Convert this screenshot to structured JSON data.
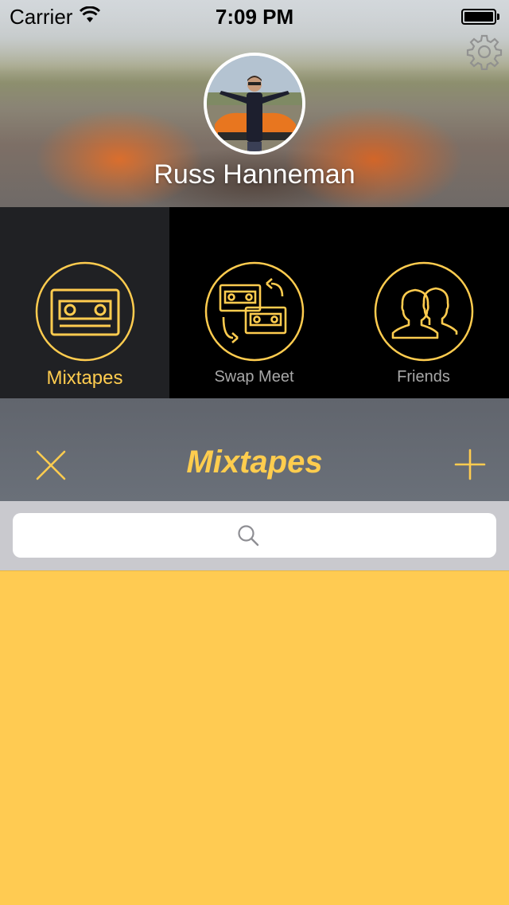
{
  "status_bar": {
    "carrier": "Carrier",
    "time": "7:09 PM",
    "wifi_icon": "wifi-icon",
    "battery_icon": "battery-full-icon"
  },
  "profile": {
    "name": "Russ Hanneman",
    "avatar_icon": "profile-photo",
    "settings_icon": "gear-icon"
  },
  "tabs": [
    {
      "label": "Mixtapes",
      "icon": "cassette-icon",
      "active": true
    },
    {
      "label": "Swap Meet",
      "icon": "cassette-swap-icon",
      "active": false
    },
    {
      "label": "Friends",
      "icon": "friends-icon",
      "active": false
    }
  ],
  "nav": {
    "title": "Mixtapes",
    "left_icon": "close-icon",
    "right_icon": "plus-icon"
  },
  "search": {
    "value": "",
    "placeholder": "",
    "icon": "search-icon"
  },
  "colors": {
    "accent": "#ffcc4f",
    "content_background": "#ffcb52",
    "tab_active_background": "#202124",
    "nav_background": "#686d76"
  }
}
